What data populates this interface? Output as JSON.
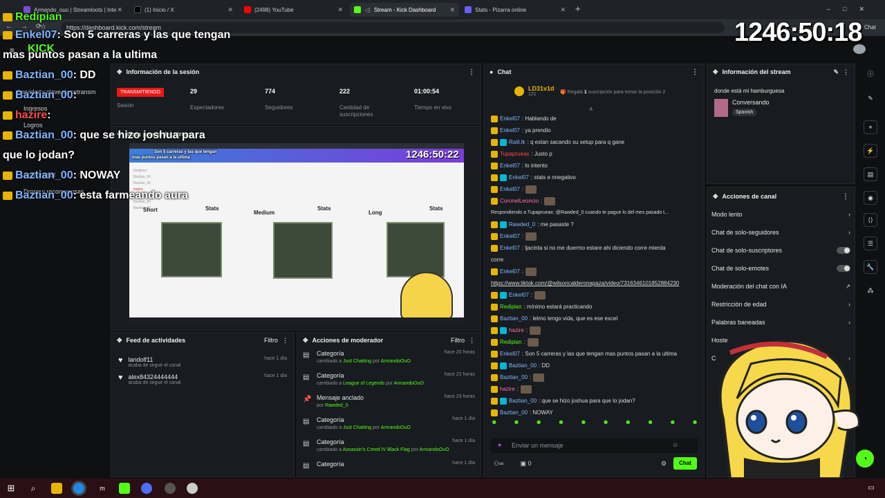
{
  "browser": {
    "tabs": [
      {
        "label": "Armando_ouo | Streamloots | Inte"
      },
      {
        "label": "(1) Inicio / X"
      },
      {
        "label": "(2498) YouTube"
      },
      {
        "label": "Stream - Kick Dashboard"
      },
      {
        "label": "Stats - Pizarra online"
      }
    ],
    "url": "https://dashboard.kick.com/stream",
    "chat_label": "Chat"
  },
  "timer": "1246:50:18",
  "overlay_chat": [
    {
      "user": "Redipian",
      "text": ""
    },
    {
      "user": "Enkel07",
      "text": ": Son 5 carreras y las que tengan"
    },
    {
      "user": "",
      "text": "mas puntos pasan a la ultima"
    },
    {
      "user": "Baztian_00",
      "text": ": DD"
    },
    {
      "user": "Baztian_00",
      "text": ":"
    },
    {
      "user": "hazire",
      "text": ":"
    },
    {
      "user": "Baztian_00",
      "text": ": que se hizo joshua para"
    },
    {
      "user": "",
      "text": "que lo jodan?"
    },
    {
      "user": "Baztian_00",
      "text": ": NOWAY"
    },
    {
      "user": "Baztian_00",
      "text": ": esta farmeando aura"
    }
  ],
  "sidebar": {
    "items": [
      "Servidor y clave de retransm",
      "Ingresos",
      "Logros",
      "Comunidad",
      "Drops y recompensas"
    ]
  },
  "session": {
    "title": "Información de la sesión",
    "status": "TRANSMITIENDO",
    "status_label": "Sesión",
    "stats": [
      {
        "value": "29",
        "label": "Espectadores"
      },
      {
        "value": "774",
        "label": "Seguidores"
      },
      {
        "value": "222",
        "label": "Cantidad de suscripciones"
      },
      {
        "value": "01:00:54",
        "label": "Tiempo en vivo"
      }
    ]
  },
  "preview": {
    "title": "Vista previa del stream",
    "inner_timer": "1246:50:22",
    "inner_text_1": "Son 5 carreras y las que tengan",
    "inner_text_2": "mas puntos pasan a la ultima",
    "boards": [
      {
        "label": "Short",
        "title": "Stats"
      },
      {
        "label": "Medium",
        "title": "Stats"
      },
      {
        "label": "Long",
        "title": "Stats"
      }
    ],
    "stars": [
      "Redipian",
      "Baztian_00",
      "Baztian_00",
      "hazire",
      "Baztian_00",
      "Baztian_00",
      "Baztian_00"
    ]
  },
  "feed": {
    "title": "Feed de actividades",
    "filter": "Filtro",
    "items": [
      {
        "user": "landolf11",
        "action": "acaba de seguir el canal",
        "time": "hace 1 día"
      },
      {
        "user": "alex84324444444",
        "action": "acaba de seguir el canal",
        "time": "hace 1 día"
      }
    ]
  },
  "mod": {
    "title": "Acciones de moderador",
    "filter": "Filtro",
    "items": [
      {
        "title": "Categoría",
        "pre": "cambiado a ",
        "target": "Just Chatting",
        "mid": " por ",
        "by": "ArmandoOuO",
        "time": "hace 20 horas"
      },
      {
        "title": "Categoría",
        "pre": "cambiado a ",
        "target": "League of Legends",
        "mid": " por ",
        "by": "ArmandoOuO",
        "time": "hace 22 horas"
      },
      {
        "title": "Mensaje anclado",
        "pre": "por ",
        "target": "Rawded_0",
        "mid": "",
        "by": "",
        "time": "hace 23 horas"
      },
      {
        "title": "Categoría",
        "pre": "cambiado a ",
        "target": "Just Chatting",
        "mid": " por ",
        "by": "ArmandoOuO",
        "time": "hace 1 día"
      },
      {
        "title": "Categoría",
        "pre": "cambiado a ",
        "target": "Assassin's Creed IV Black Flag",
        "mid": " por ",
        "by": "ArmandoOuO",
        "time": "hace 1 día"
      },
      {
        "title": "Categoría",
        "pre": "",
        "target": "",
        "mid": "",
        "by": "",
        "time": "hace 1 día"
      }
    ]
  },
  "chat": {
    "title": "Chat",
    "gifter": {
      "name": "LD31v1d",
      "count": "121"
    },
    "gift_text_1": "Regala ",
    "gift_num": "1",
    "gift_text_2": " suscripción para tomar la posición 2",
    "reply_text": "Respondiendo a Tupaprueax: @Rawded_0 cuando te pague lo del mes pasado t...",
    "messages": [
      {
        "u": "Enkel07",
        "c": "u1",
        "t": ": Hablando de"
      },
      {
        "u": "Enkel07",
        "c": "u1",
        "t": ": ya prendio"
      },
      {
        "u": "Raiil.lk",
        "c": "u1",
        "t": ": q        estan sacando su setup para q gane"
      },
      {
        "u": "Tupaprueax",
        "c": "u4",
        "t": ": Justo p"
      },
      {
        "u": "Enkel07",
        "c": "u1",
        "t": ": lo intento"
      },
      {
        "u": "Enkel07",
        "c": "u1",
        "t": ": stats e nnegativo"
      },
      {
        "u": "Enkel07",
        "c": "u1",
        "t": ":"
      },
      {
        "u": "CoronelLeoncio",
        "c": "u3",
        "t": ":"
      },
      {
        "u": "Rawded_0",
        "c": "u1",
        "t": ": me pasaste ?"
      },
      {
        "u": "Enkel07",
        "c": "u1",
        "t": ":"
      },
      {
        "u": "Enkel07",
        "c": "u1",
        "t": ": ljacinta si no me duermo        estare ahi diciendo corre mierda"
      },
      {
        "u": "",
        "c": "u1",
        "t": "corre"
      },
      {
        "u": "Enkel07",
        "c": "u1",
        "t": ":"
      },
      {
        "u": "",
        "c": "u1",
        "t": "https://www.tiktok.com/@wilsoncalderonapaza/video/7316346101852884230"
      },
      {
        "u": "Enkel07",
        "c": "u1",
        "t": ":"
      },
      {
        "u": "Redipian",
        "c": "u2",
        "t": ": mínimo estará practicando"
      },
      {
        "u": "Baztian_00",
        "c": "u1",
        "t": ": lelmo        tengo vida, que es ese excel"
      },
      {
        "u": "hazire",
        "c": "u3",
        "t": ":"
      },
      {
        "u": "Redipian",
        "c": "u2",
        "t": ":"
      },
      {
        "u": "Enkel07",
        "c": "u1",
        "t": ": Son 5 carreras y las que tengan mas puntos pasan a la ultima"
      },
      {
        "u": "Baztian_00",
        "c": "u1",
        "t": ": DD"
      },
      {
        "u": "Baztian_00",
        "c": "u1",
        "t": ":"
      },
      {
        "u": "hazire",
        "c": "u3",
        "t": ":"
      },
      {
        "u": "Baztian_00",
        "c": "u1",
        "t": ": que se hizo joshua para que lo jodan?"
      },
      {
        "u": "Baztian_00",
        "c": "u1",
        "t": ": NOWAY"
      }
    ],
    "input_placeholder": "Enviar un mensaje",
    "points": "0",
    "send": "Chat"
  },
  "stream_info": {
    "title": "Información del stream",
    "stream_title": "donde está mi hamburguesa",
    "category": "Conversando",
    "language": "Spanish"
  },
  "channel_actions": {
    "title": "Acciones de canal",
    "items": [
      {
        "label": "Modo lento",
        "kind": "chev"
      },
      {
        "label": "Chat de solo-seguidores",
        "kind": "chev"
      },
      {
        "label": "Chat de solo-suscriptores",
        "kind": "toggle"
      },
      {
        "label": "Chat de solo-emotes",
        "kind": "toggle"
      },
      {
        "label": "Moderación del chat con IA",
        "kind": "ext"
      },
      {
        "label": "Restricción de edad",
        "kind": "chev"
      },
      {
        "label": "Palabras baneadas",
        "kind": "chev"
      },
      {
        "label": "Hoste",
        "kind": ""
      },
      {
        "label": "C",
        "kind": "chev"
      }
    ]
  },
  "colors": {
    "kick_green": "#53fc18",
    "live_red": "#e91916"
  }
}
